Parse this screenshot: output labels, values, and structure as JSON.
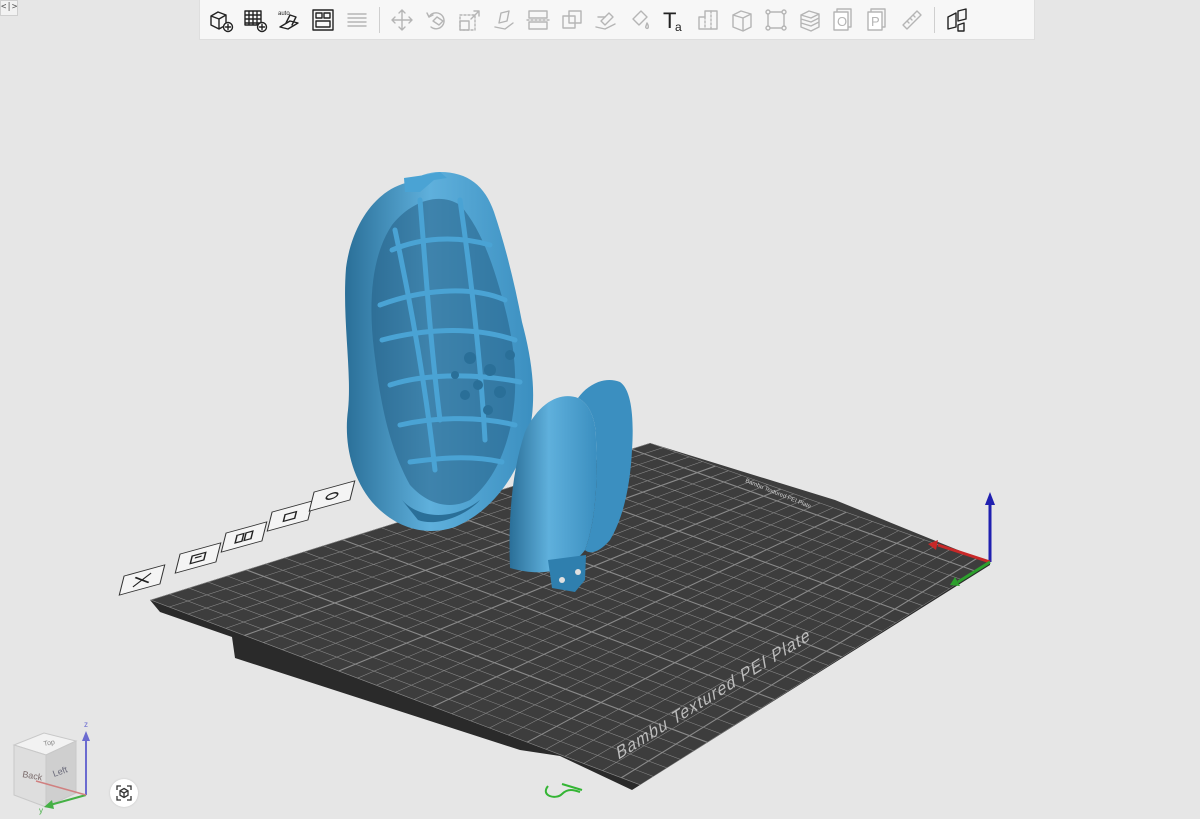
{
  "app": {
    "panel_toggle_glyph": "<|>"
  },
  "toolbar": {
    "groups": [
      [
        {
          "name": "add-cube-icon",
          "interactable": true,
          "disabled": false
        },
        {
          "name": "add-plate-icon",
          "interactable": true,
          "disabled": false
        },
        {
          "name": "auto-orient-icon",
          "interactable": true,
          "disabled": false,
          "label": "auto"
        },
        {
          "name": "arrange-icon",
          "interactable": true,
          "disabled": false
        },
        {
          "name": "layers-icon",
          "interactable": true,
          "disabled": true
        }
      ],
      [
        {
          "name": "move-icon",
          "interactable": true,
          "disabled": true
        },
        {
          "name": "rotate-icon",
          "interactable": true,
          "disabled": true
        },
        {
          "name": "scale-icon",
          "interactable": true,
          "disabled": true
        },
        {
          "name": "lay-on-face-icon",
          "interactable": true,
          "disabled": true
        },
        {
          "name": "cut-icon",
          "interactable": true,
          "disabled": true
        },
        {
          "name": "boolean-icon",
          "interactable": true,
          "disabled": true
        },
        {
          "name": "support-paint-icon",
          "interactable": true,
          "disabled": true
        },
        {
          "name": "color-paint-icon",
          "interactable": true,
          "disabled": true
        },
        {
          "name": "text-emboss-icon",
          "interactable": true,
          "disabled": false,
          "label": "T",
          "sublabel": "a"
        },
        {
          "name": "seam-paint-icon",
          "interactable": true,
          "disabled": true
        },
        {
          "name": "cube-object-icon",
          "interactable": true,
          "disabled": true
        },
        {
          "name": "bounding-box-icon",
          "interactable": true,
          "disabled": true
        },
        {
          "name": "variable-layer-icon",
          "interactable": true,
          "disabled": true
        },
        {
          "name": "object-o-icon",
          "interactable": true,
          "disabled": true,
          "label": "O"
        },
        {
          "name": "object-p-icon",
          "interactable": true,
          "disabled": true,
          "label": "P"
        },
        {
          "name": "measure-icon",
          "interactable": true,
          "disabled": true
        }
      ],
      [
        {
          "name": "assembly-icon",
          "interactable": true,
          "disabled": false
        }
      ]
    ]
  },
  "colors": {
    "background": "#e6e6e6",
    "plate": "#3d3d3d",
    "plate_grid": "#8a8a8a",
    "model": "#3b8fc0",
    "model_dark": "#2a6f98",
    "model_light": "#5fb0dc",
    "axis_x": "#c82828",
    "axis_y": "#2da02d",
    "axis_z": "#2020b0"
  },
  "plate": {
    "name": "Bambu Textured PEI Plate",
    "top_strip_label": "Bambu Textured PEI Plate"
  },
  "plate_tools": [
    {
      "name": "plate-delete-icon"
    },
    {
      "name": "plate-orient-icon"
    },
    {
      "name": "plate-arrange-icon"
    },
    {
      "name": "plate-lock-icon"
    },
    {
      "name": "plate-settings-icon"
    }
  ],
  "viewcube": {
    "faces": {
      "top": "Top",
      "front": "Back",
      "side": "Left"
    },
    "axes": {
      "z": "z",
      "y": "y"
    }
  },
  "view_button": {
    "name": "camera-view-icon"
  }
}
